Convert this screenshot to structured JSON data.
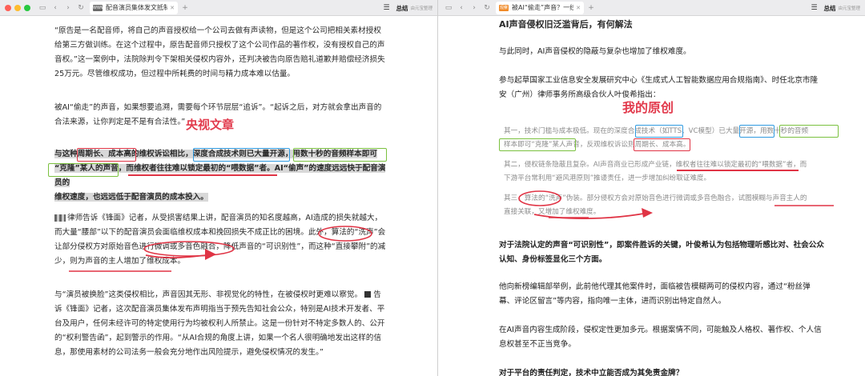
{
  "colors": {
    "red": "#e03445",
    "blue": "#2f9ae0",
    "green": "#7bc13f",
    "annotation": "#e23b4d"
  },
  "left": {
    "tab": {
      "favicon": "WWW",
      "title": "配音演员集体发文抵制AI，这"
    },
    "summary": {
      "label": "总结",
      "sub": "由元宝整理"
    },
    "p1": [
      "“原告是一名配音师，将自己的声音授权给一个公司去做有声读物，但是这个公司把相关素材授权",
      "给第三方做训练。在这个过程中，原告配音师只授权了这个公司作品的著作权，没有授权自己的声",
      "音权。”这一案例中，法院除判令下架相关侵权内容外，还判决被告向原告赔礼道歉并赔偿经济损失",
      "25万元。尽管维权成功，但过程中所耗费的时间与精力成本难以估量。"
    ],
    "p2": [
      "被AI“偷走”的声音，如果想要追溯，需要每个环节层层“追诉”。“起诉之后，对方就会拿出声音的",
      "合法来源，让你判定是不是有合法性。”"
    ],
    "label_left": "央视文章",
    "p3": {
      "l1a": "与这种",
      "l1b": "周期长、成本高",
      "l1c": "的维权诉讼相比，",
      "l1d": "深度合成技术则已大量开源",
      "l1e": "，",
      "l1f": "用数十秒的音频样本即可",
      "l2a": "“克隆”某人的声音",
      "l2b": "，",
      "l2c": "而维权者往往难以锁定最初的“喂数据”者",
      "l2d": "。AI“偷声”的速度远远快于配音演员的",
      "l3": "维权速度，也远远低于配音演员的成本投入。"
    },
    "p4": [
      "律师告诉《锋面》记者，从受损害结果上讲，配音演员的知名度越高，AI造成的损失就越大，",
      "而大量“腰部”以下的配音演员会面临维权成本和挽回损失不成正比的困境。此外，",
      "算法的“洗声”",
      "会",
      "让部分侵权方对原始音色进行微调或多音色融合，降低声音的“可识别性”，而这种“直接攀附”的减",
      "少，则为声音的主人增加了维权成本。"
    ],
    "p5": [
      "与“演员被换脸”这类侵权相比，声音因其无形、非视觉化的特性，在被侵权时更难以察觉。",
      "告",
      "诉《锋面》记者，这次配音演员集体发布声明指当于预先告知社会公众，特别是AI技术开发者、平",
      "台及用户，任何未经许可的特定使用行为均被权利人所禁止。这是一份针对不特定多数人的、公开",
      "的“权利警告函”，起到警示的作用。“从AI合规的角度上讲，如果一个名人很明确地发出这样的信",
      "息，那使用素材的公司法务一般会充分地作出风险提示，避免侵权情况的发生。”"
    ]
  },
  "right": {
    "tab": {
      "favicon": "观察",
      "title": "被AI“偷走”声音？一线配音演"
    },
    "summary": {
      "label": "总结",
      "sub": "由元宝整理"
    },
    "heading": "AI声音侵权旧泛滥背后，有何解法",
    "p1": "与此同时，AI声音侵权的隐蔽与复杂也增加了维权难度。",
    "p2": [
      "参与起草国家工业信息安全发展研究中心《生成式人工智能数据应用合规指南》、时任北京市隆",
      "安（广州）律师事务所高级合伙人叶俊希指出："
    ],
    "label_right": "我的原创",
    "q1": {
      "a": "其一，技术门槛与成本极低。现在的",
      "b": "深度合成技术",
      "c": "（如TTS、VC模型）",
      "d": "已大量开源",
      "e": "，",
      "f": "用数十秒的音频",
      "g": "样本即可“克隆”某人声音",
      "h": "，反观维权诉讼则",
      "i": "周期长、成本高",
      "j": "。"
    },
    "q2": [
      "其二，侵权链条隐蔽且复杂。AI声音商业已形成产业链，维权者往往难以锁定最初的“喂数据”者，而",
      "下游平台常利用“避风港原则”推诿责任，进一步增加纠纷取证难度。"
    ],
    "q3": [
      "其三，",
      "算法的“洗声",
      "”伪装。部分侵权方会对原始音色进行微调或多音色融合，试图模糊与声音主人的",
      "直接关联，又增加了维权难度。"
    ],
    "p3": [
      "对于法院认定的声音“可识别性”，即案件胜诉的关键，叶俊希认为包括物理听感比对、社会公众",
      "认知、身份标签显化三个方面。"
    ],
    "p4": [
      "他向新榜编辑部举例，此前他代理其他案件时，面临被告模糊两可的侵权内容，通过“粉丝弹",
      "幕、评论区留言”等内容，指向唯一主体，进而识别出特定自然人。"
    ],
    "p5": [
      "在AI声音内容生成阶段，侵权定性更加多元。根据案情不同，可能触及人格权、著作权、个人信",
      "息权甚至不正当竞争。"
    ],
    "p6": "对于平台的责任判定，技术中立能否成为其免责金牌？"
  }
}
